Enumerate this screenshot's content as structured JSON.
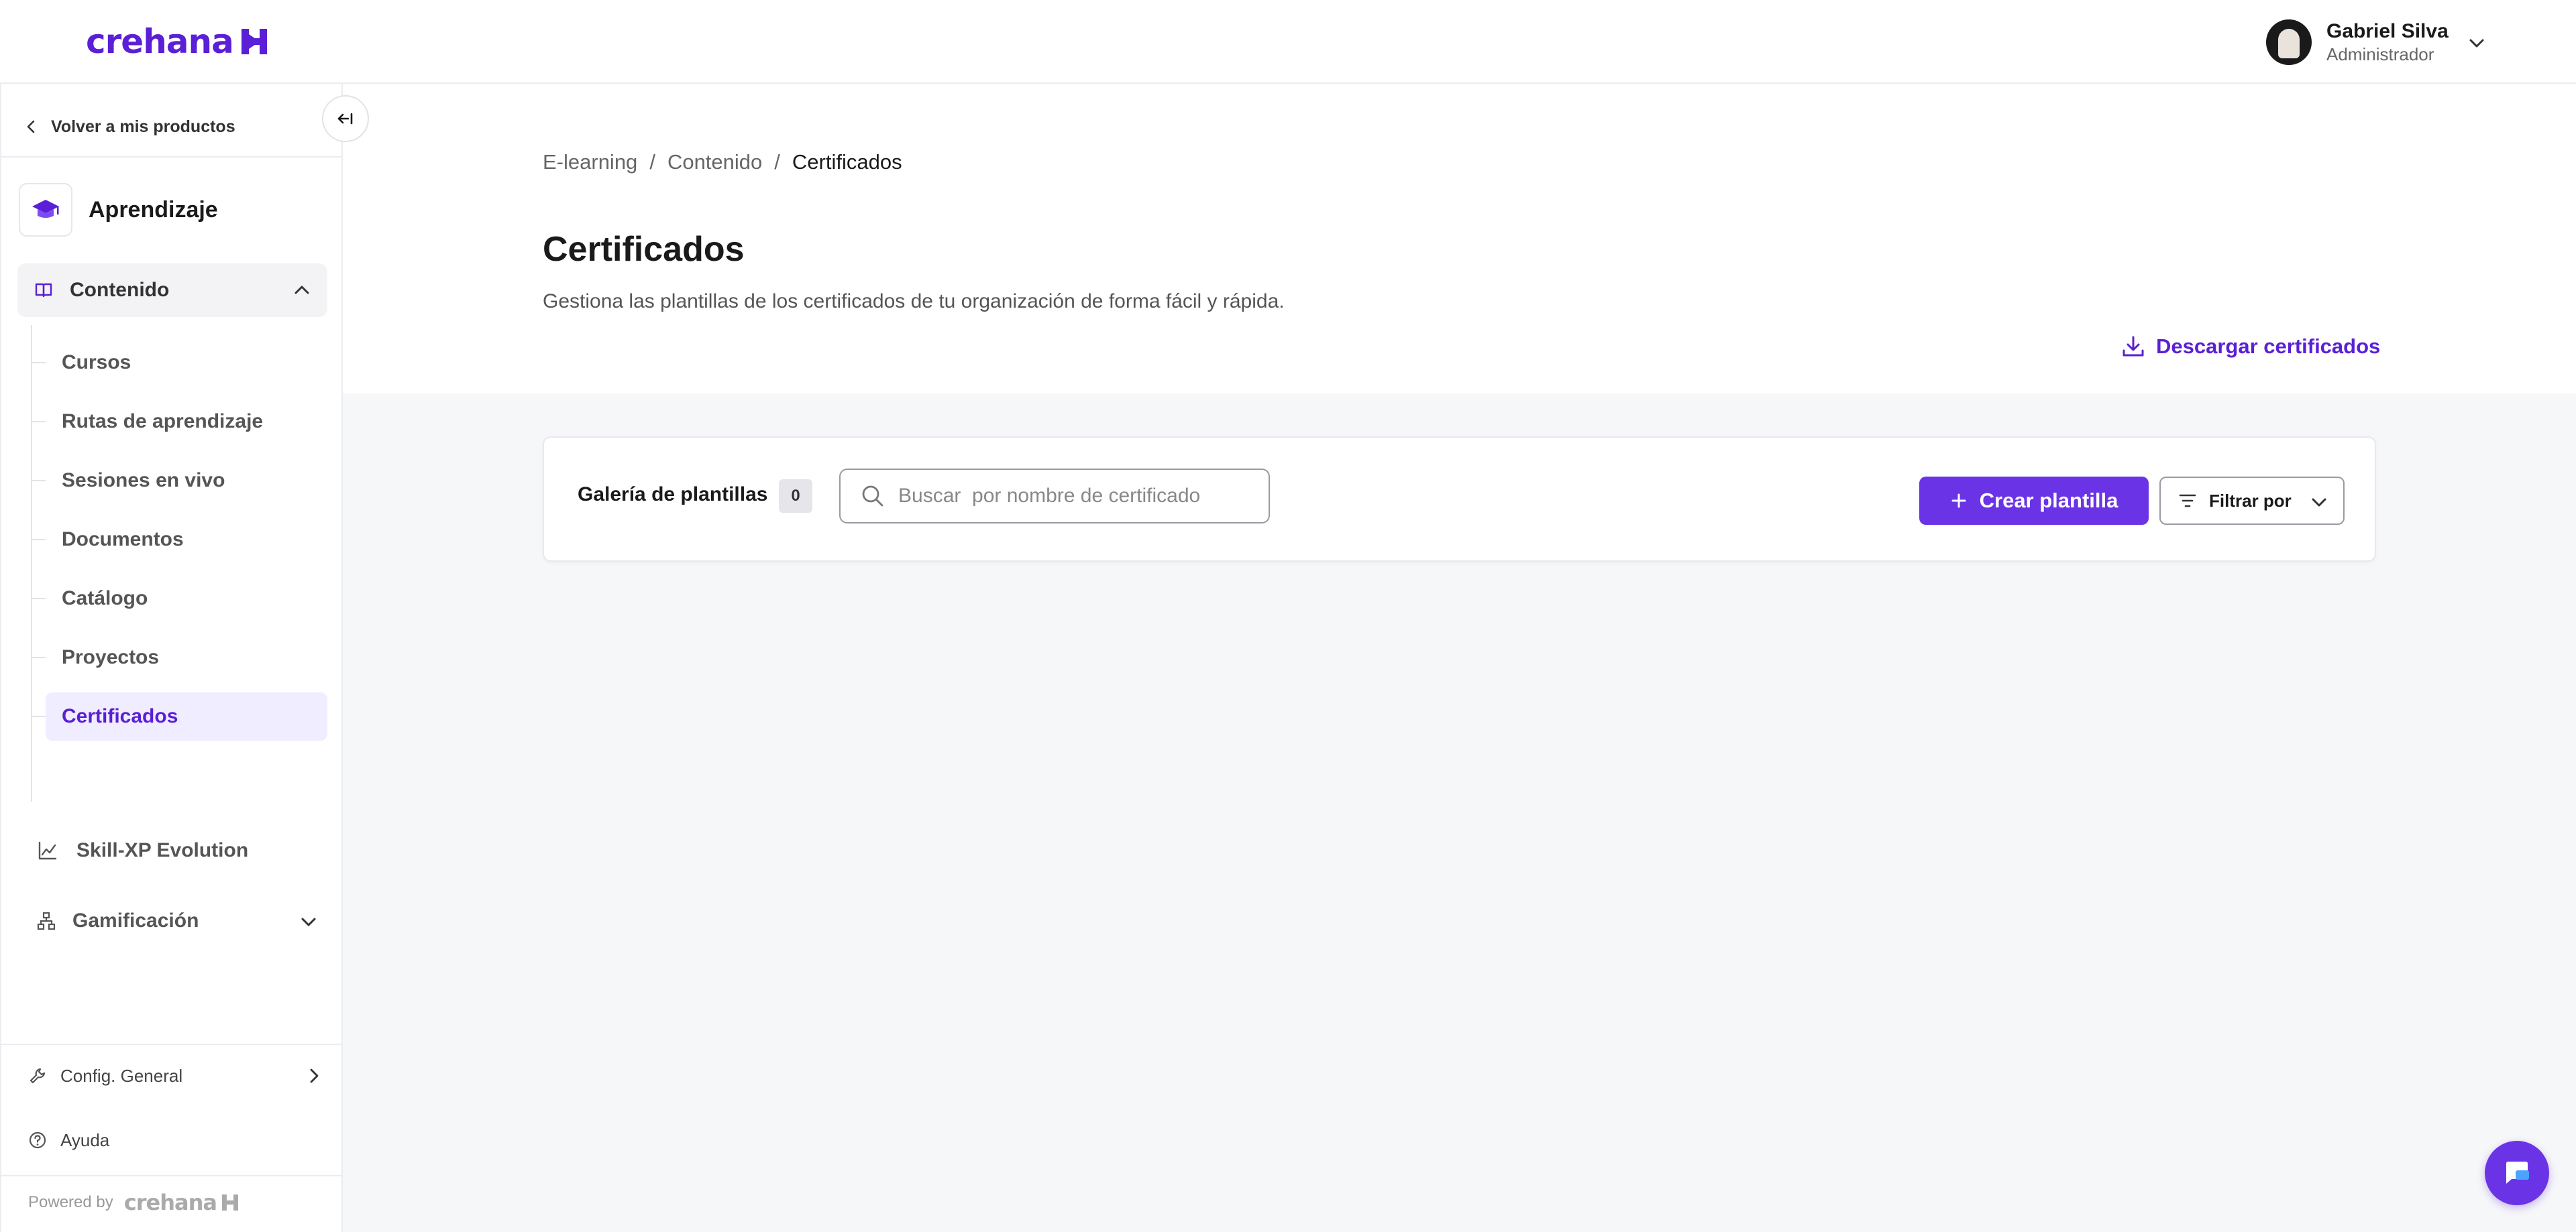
{
  "header": {
    "logo_text": "crehana",
    "user": {
      "name": "Gabriel Silva",
      "role": "Administrador"
    }
  },
  "sidebar": {
    "back_label": "Volver a mis productos",
    "product_name": "Aprendizaje",
    "content_section": {
      "label": "Contenido",
      "items": [
        {
          "label": "Cursos"
        },
        {
          "label": "Rutas de aprendizaje"
        },
        {
          "label": "Sesiones en vivo"
        },
        {
          "label": "Documentos"
        },
        {
          "label": "Catálogo"
        },
        {
          "label": "Proyectos"
        },
        {
          "label": "Certificados"
        }
      ]
    },
    "skill_label": "Skill-XP Evolution",
    "gamification_label": "Gamificación",
    "config_label": "Config. General",
    "help_label": "Ayuda",
    "powered_by": "Powered by",
    "powered_logo": "crehana"
  },
  "main": {
    "breadcrumb": [
      "E-learning",
      "Contenido",
      "Certificados"
    ],
    "breadcrumb_sep": "/",
    "title": "Certificados",
    "description": "Gestiona las plantillas de los certificados de tu organización de forma fácil y rápida.",
    "download_label": "Descargar certificados",
    "gallery": {
      "title": "Galería de plantillas",
      "count": "0",
      "search_placeholder": "Buscar  por nombre de certificado",
      "create_label": "Crear plantilla",
      "filter_label": "Filtrar por"
    }
  },
  "colors": {
    "brand": "#5a1fd6",
    "button": "#6a34e6",
    "active_bg": "#efedff",
    "page_bg": "#f6f7f9"
  },
  "icons": [
    "chevron-left-icon",
    "graduation-cap-icon",
    "collapse-sidebar-icon",
    "book-icon",
    "chevron-up-icon",
    "chart-icon",
    "gamification-icon",
    "chevron-down-icon",
    "wrench-icon",
    "chevron-right-icon",
    "help-circle-icon",
    "download-icon",
    "search-icon",
    "plus-icon",
    "filter-icon",
    "chat-icon"
  ]
}
